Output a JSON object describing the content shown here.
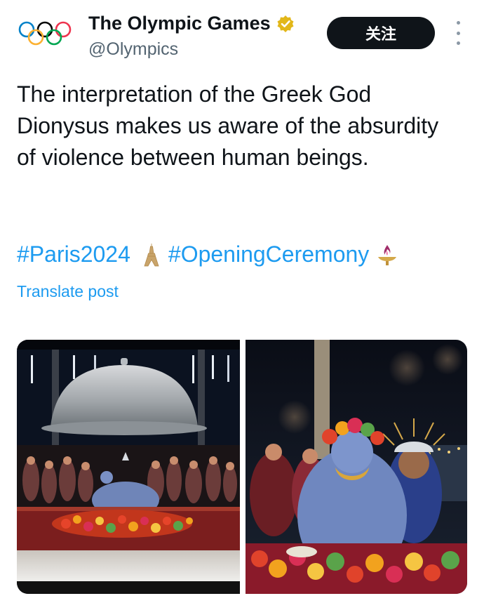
{
  "account": {
    "display_name": "The Olympic Games",
    "handle": "@Olympics",
    "avatar_icon": "olympic-rings-icon",
    "verified_icon": "verified-badge-icon",
    "verified_color": "#e2b719"
  },
  "actions": {
    "follow_label": "关注",
    "more_icon": "more-vertical-icon"
  },
  "post": {
    "text": "The interpretation of the Greek God Dionysus makes us aware of the absurdity of violence between human beings.",
    "hashtags": [
      {
        "text": "#Paris2024",
        "emoji_icon": "eiffel-tower-icon"
      },
      {
        "text": "#OpeningCeremony",
        "emoji_icon": "torch-flame-icon"
      }
    ],
    "translate_label": "Translate post"
  },
  "media": [
    {
      "name": "banquet-stage-photo"
    },
    {
      "name": "blue-performer-photo"
    }
  ],
  "colors": {
    "link": "#1d9bf0",
    "text": "#0f1419",
    "secondary": "#536471",
    "button_bg": "#0f1419"
  }
}
